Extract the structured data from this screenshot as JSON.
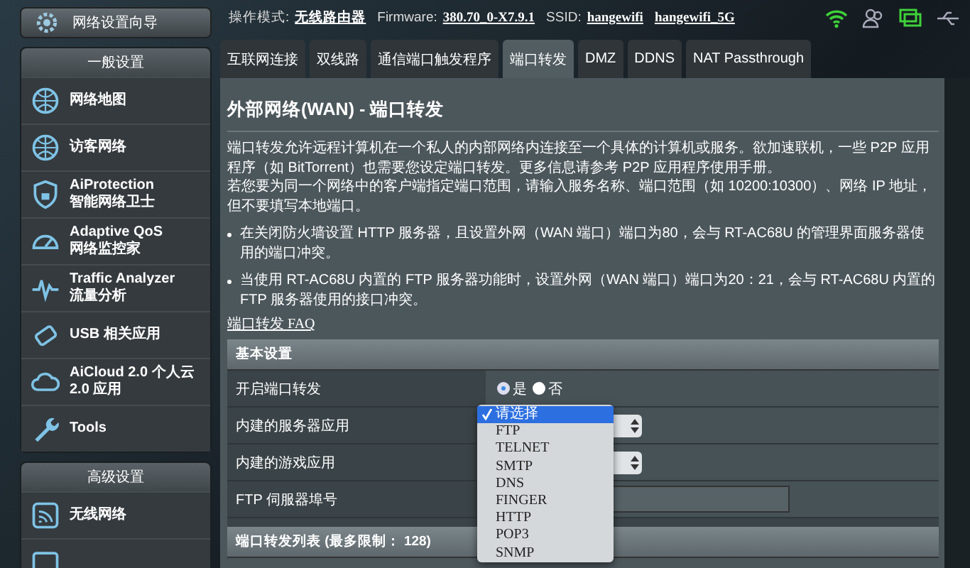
{
  "header": {
    "mode_label": "操作模式:",
    "mode": "无线路由器",
    "firmware_label": "Firmware:",
    "firmware": "380.70_0-X7.9.1",
    "ssid_label": "SSID:",
    "ssids": [
      "hangewifi",
      "hangewifi_5G"
    ]
  },
  "wizard": {
    "label": "网络设置向导"
  },
  "sidebar": [
    {
      "title": "一般设置",
      "items": [
        {
          "kind": "map",
          "label": "网络地图"
        },
        {
          "kind": "guest",
          "label": "访客网络"
        },
        {
          "kind": "shield",
          "label": "AiProtection",
          "sublabel": "智能网络卫士"
        },
        {
          "kind": "gauge",
          "label": "Adaptive QoS",
          "sublabel": "网络监控家"
        },
        {
          "kind": "pulse",
          "label": "Traffic Analyzer",
          "sublabel": "流量分析"
        },
        {
          "kind": "usb",
          "label": "USB 相关应用"
        },
        {
          "kind": "cloud",
          "label": "AiCloud 2.0 个人云 2.0 应用"
        },
        {
          "kind": "wrench",
          "label": "Tools"
        }
      ]
    },
    {
      "title": "高级设置",
      "items": [
        {
          "kind": "wifi",
          "label": "无线网络"
        },
        {
          "kind": "box"
        }
      ]
    }
  ],
  "tabs": [
    {
      "label": "互联网连接",
      "selected": false
    },
    {
      "label": "双线路",
      "selected": false
    },
    {
      "label": "通信端口触发程序",
      "selected": false
    },
    {
      "label": "端口转发",
      "selected": true
    },
    {
      "label": "DMZ",
      "selected": false
    },
    {
      "label": "DDNS",
      "selected": false
    },
    {
      "label": "NAT Passthrough",
      "selected": false
    }
  ],
  "page": {
    "title": "外部网络(WAN) - 端口转发",
    "paragraphs": [
      "端口转发允许远程计算机在一个私人的内部网络内连接至一个具体的计算机或服务。欲加速联机，一些 P2P 应用程序（如 BitTorrent）也需要您设定端口转发。更多信息请参考 P2P 应用程序使用手册。",
      "若您要为同一个网络中的客户端指定端口范围，请输入服务名称、端口范围（如 10200:10300）、网络 IP 地址，但不要填写本地端口。"
    ],
    "bullets": [
      "在关闭防火墙设置 HTTP 服务器，且设置外网（WAN 端口）端口为80，会与 RT-AC68U 的管理界面服务器使用的端口冲突。",
      "当使用 RT-AC68U 内置的 FTP 服务器功能时，设置外网（WAN 端口）端口为20：21，会与 RT-AC68U 内置的 FTP 服务器使用的接口冲突。"
    ],
    "faq_link": "端口转发 FAQ"
  },
  "basic": {
    "title": "基本设置",
    "rows": [
      {
        "kind": "radio",
        "label": "开启端口转发",
        "options": [
          {
            "label": "是",
            "selected": true
          },
          {
            "label": "否",
            "selected": false
          }
        ]
      },
      {
        "kind": "select",
        "label": "内建的服务器应用"
      },
      {
        "kind": "select",
        "label": "内建的游戏应用"
      },
      {
        "kind": "input",
        "label": "FTP 伺服器埠号"
      }
    ]
  },
  "dropdown": {
    "options": [
      {
        "label": "请选择",
        "selected": true
      },
      {
        "label": "FTP",
        "selected": false
      },
      {
        "label": "TELNET",
        "selected": false
      },
      {
        "label": "SMTP",
        "selected": false
      },
      {
        "label": "DNS",
        "selected": false
      },
      {
        "label": "FINGER",
        "selected": false
      },
      {
        "label": "HTTP",
        "selected": false
      },
      {
        "label": "POP3",
        "selected": false
      },
      {
        "label": "SNMP",
        "selected": false
      }
    ]
  },
  "list": {
    "title": "端口转发列表 (最多限制： 128)"
  }
}
